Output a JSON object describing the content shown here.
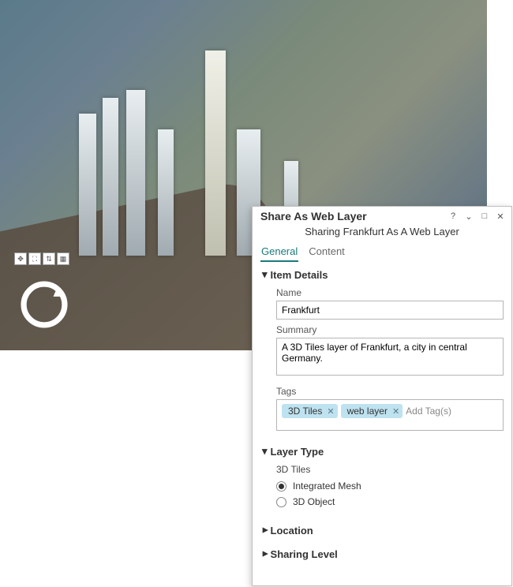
{
  "panel": {
    "title": "Share As Web Layer",
    "subtitle": "Sharing Frankfurt As A Web Layer",
    "tabs": {
      "general": "General",
      "content": "Content"
    },
    "sections": {
      "item_details": {
        "header": "Item Details",
        "name_label": "Name",
        "name_value": "Frankfurt",
        "summary_label": "Summary",
        "summary_value": "A 3D Tiles layer of Frankfurt, a city in central Germany.",
        "tags_label": "Tags",
        "tags": [
          "3D Tiles",
          "web layer"
        ],
        "tags_placeholder": "Add Tag(s)"
      },
      "layer_type": {
        "header": "Layer Type",
        "subtype": "3D Tiles",
        "options": {
          "integrated_mesh": "Integrated Mesh",
          "3d_object": "3D Object"
        },
        "selected": "integrated_mesh"
      },
      "location": {
        "header": "Location"
      },
      "sharing_level": {
        "header": "Sharing Level"
      }
    },
    "window_controls": {
      "help": "?",
      "menu": "⌄",
      "max": "□",
      "close": "✕"
    }
  }
}
